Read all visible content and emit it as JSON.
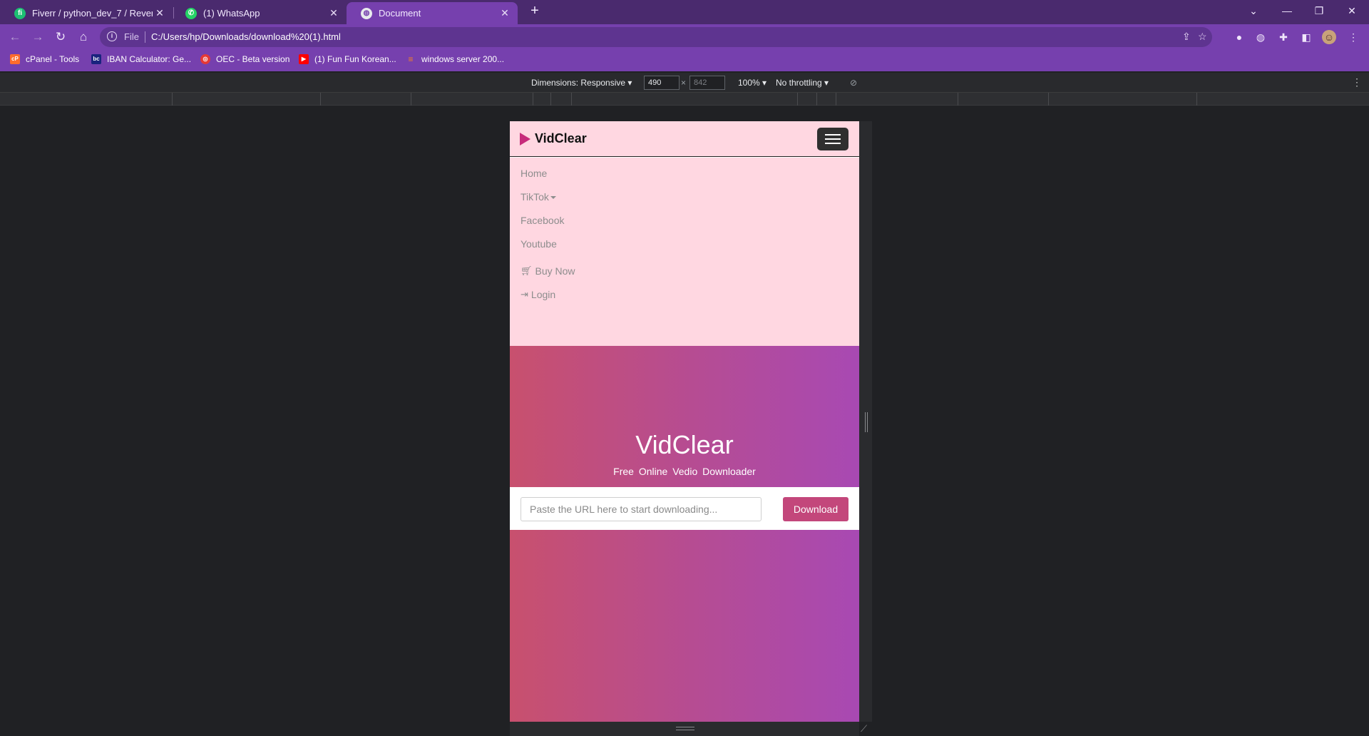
{
  "browser": {
    "tabs": [
      {
        "title": "Fiverr / python_dev_7 / Revenues",
        "icon": "fiverr-icon",
        "icon_color": "#1dbf73",
        "active": false
      },
      {
        "title": "(1) WhatsApp",
        "icon": "whatsapp-icon",
        "icon_color": "#25d366",
        "active": false
      },
      {
        "title": "Document",
        "icon": "globe-icon",
        "icon_color": "#e8eaed",
        "active": true
      }
    ],
    "address": {
      "scheme_label": "File",
      "url": "C:/Users/hp/Downloads/download%20(1).html"
    },
    "bookmarks": [
      {
        "label": "cPanel - Tools",
        "icon": "cpanel-icon",
        "color": "#ff6c2c"
      },
      {
        "label": "IBAN Calculator: Ge...",
        "icon": "iban-icon",
        "color": "#1a237e"
      },
      {
        "label": "OEC - Beta version",
        "icon": "oec-icon",
        "color": "#e53935"
      },
      {
        "label": "(1) Fun Fun Korean...",
        "icon": "youtube-icon",
        "color": "#ff0000"
      },
      {
        "label": "windows server 200...",
        "icon": "stackoverflow-icon",
        "color": "#f48024"
      }
    ],
    "accent_color": "#7640ae"
  },
  "devtools": {
    "dimensions_label": "Dimensions: Responsive",
    "width": "490",
    "height_placeholder": "842",
    "times": "×",
    "zoom": "100%",
    "throttling": "No throttling"
  },
  "site": {
    "brand": "VidClear",
    "menu": {
      "home": "Home",
      "tiktok": "TikTok",
      "facebook": "Facebook",
      "youtube": "Youtube",
      "buy_now": "Buy Now",
      "login": "Login"
    },
    "hero": {
      "title": "VidClear",
      "subtitle": "Free Online Vedio Downloader"
    },
    "downloader": {
      "placeholder": "Paste the URL here to start downloading...",
      "button": "Download"
    },
    "colors": {
      "navbar_bg": "#ffd7e1",
      "gradient_start": "#c8506e",
      "gradient_end": "#a849b3",
      "button": "#c3477b"
    }
  }
}
